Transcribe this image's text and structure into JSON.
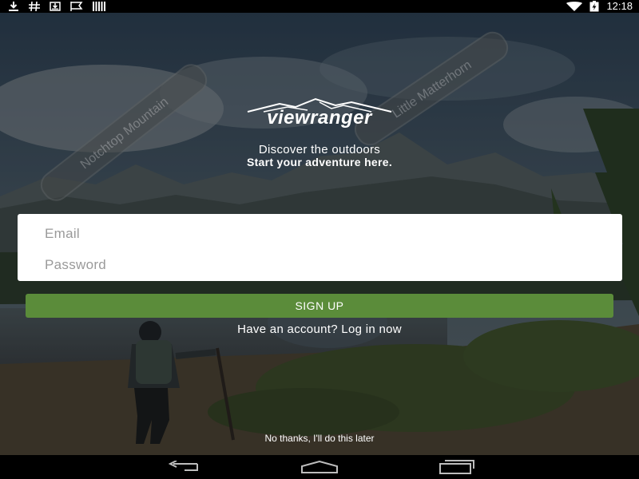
{
  "status_bar": {
    "left_icons": [
      "download-icon",
      "hash-icon",
      "download-box-icon",
      "flag-icon",
      "barcode-icon"
    ],
    "right_icons": [
      "wifi-icon",
      "battery-charging-icon"
    ],
    "time": "12:18"
  },
  "background": {
    "sign_left": "Notchtop Mountain",
    "sign_right": "Little Matterhorn"
  },
  "branding": {
    "logo_text": "viewranger",
    "tagline_line1": "Discover the outdoors",
    "tagline_line2": "Start your adventure here."
  },
  "form": {
    "email_placeholder": "Email",
    "password_placeholder": "Password",
    "signup_label": "SIGN UP",
    "login_prompt": "Have an account?  Log in now",
    "skip_label": "No thanks, I'll do this later"
  },
  "nav_bar": {
    "icons": [
      "back-icon",
      "home-icon",
      "recents-icon"
    ]
  },
  "colors": {
    "accent": "#5b8c3a",
    "card": "#ffffff"
  }
}
